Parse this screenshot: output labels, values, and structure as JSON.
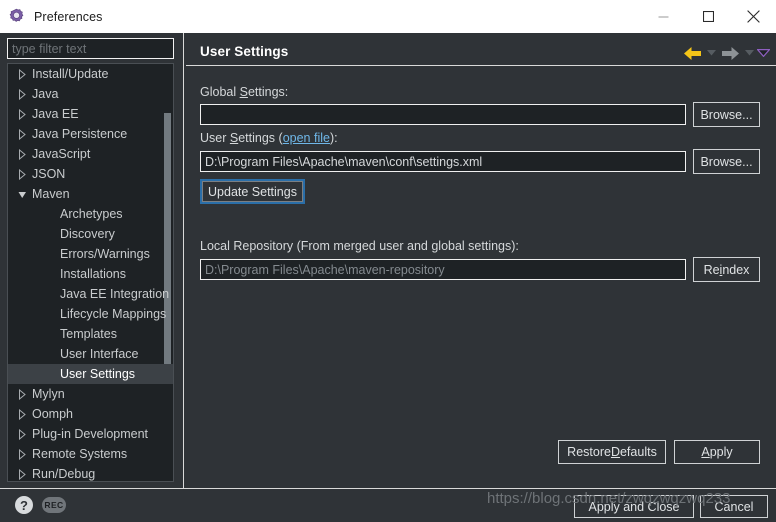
{
  "window": {
    "title": "Preferences",
    "icon": "gear-icon",
    "controls": {
      "minimize": "minimize-icon",
      "maximize": "maximize-icon",
      "close": "close-icon"
    }
  },
  "sidebar": {
    "filter": {
      "value": "",
      "placeholder": "type filter text"
    },
    "items": [
      {
        "label": "Install/Update",
        "level": 0,
        "state": "collapsed",
        "selected": false
      },
      {
        "label": "Java",
        "level": 0,
        "state": "collapsed",
        "selected": false
      },
      {
        "label": "Java EE",
        "level": 0,
        "state": "collapsed",
        "selected": false
      },
      {
        "label": "Java Persistence",
        "level": 0,
        "state": "collapsed",
        "selected": false
      },
      {
        "label": "JavaScript",
        "level": 0,
        "state": "collapsed",
        "selected": false
      },
      {
        "label": "JSON",
        "level": 0,
        "state": "collapsed",
        "selected": false
      },
      {
        "label": "Maven",
        "level": 0,
        "state": "expanded",
        "selected": false
      },
      {
        "label": "Archetypes",
        "level": 1,
        "state": "leaf",
        "selected": false
      },
      {
        "label": "Discovery",
        "level": 1,
        "state": "leaf",
        "selected": false
      },
      {
        "label": "Errors/Warnings",
        "level": 1,
        "state": "leaf",
        "selected": false
      },
      {
        "label": "Installations",
        "level": 1,
        "state": "leaf",
        "selected": false
      },
      {
        "label": "Java EE Integration",
        "level": 1,
        "state": "leaf",
        "selected": false
      },
      {
        "label": "Lifecycle Mappings",
        "level": 1,
        "state": "leaf",
        "selected": false
      },
      {
        "label": "Templates",
        "level": 1,
        "state": "leaf",
        "selected": false
      },
      {
        "label": "User Interface",
        "level": 1,
        "state": "leaf",
        "selected": false
      },
      {
        "label": "User Settings",
        "level": 1,
        "state": "leaf",
        "selected": true
      },
      {
        "label": "Mylyn",
        "level": 0,
        "state": "collapsed",
        "selected": false
      },
      {
        "label": "Oomph",
        "level": 0,
        "state": "collapsed",
        "selected": false
      },
      {
        "label": "Plug-in Development",
        "level": 0,
        "state": "collapsed",
        "selected": false
      },
      {
        "label": "Remote Systems",
        "level": 0,
        "state": "collapsed",
        "selected": false
      },
      {
        "label": "Run/Debug",
        "level": 0,
        "state": "collapsed",
        "selected": false
      }
    ]
  },
  "page": {
    "title": "User Settings",
    "nav": {
      "back": "back-arrow-icon",
      "back_menu": "chevron-down-icon",
      "forward": "forward-arrow-icon",
      "forward_menu": "chevron-down-icon",
      "view_menu": "view-menu-chevron-icon"
    },
    "global_settings": {
      "label_pre": "Global ",
      "label_mnemonic": "S",
      "label_post": "ettings:",
      "value": "",
      "placeholder": "",
      "browse_label": "Browse..."
    },
    "user_settings": {
      "label_pre": "User ",
      "label_mnemonic": "S",
      "label_mid": "ettings (",
      "link_label": "open file",
      "label_post": "):",
      "value": "D:\\Program Files\\Apache\\maven\\conf\\settings.xml",
      "browse_label": "Browse...",
      "update_label": "Update Settings"
    },
    "local_repository": {
      "label": "Local Repository (From merged user and global settings):",
      "value": "D:\\Program Files\\Apache\\maven-repository",
      "reindex_label_pre": "Re",
      "reindex_mnemonic": "i",
      "reindex_label_post": "ndex"
    },
    "restore_defaults": {
      "pre": "Restore ",
      "mnemonic": "D",
      "post": "efaults"
    },
    "apply": {
      "mnemonic": "A",
      "post": "pply"
    }
  },
  "footer": {
    "help_icon": "help-icon",
    "rec_icon": "REC",
    "apply_and_close": "Apply and Close",
    "cancel": "Cancel",
    "watermark": "https://blog.csdn.net/zwqzwqzwq233"
  },
  "colors": {
    "window_bg": "#2f3337",
    "tree_bg": "#1e2225",
    "selected_row": "#3c4146",
    "border": "#f0f0f0",
    "link": "#6fb7e8",
    "back_arrow": "#f5c518",
    "forward_arrow": "#8d9296",
    "focus_ring": "#2a6ea8",
    "titlebar_bg": "#ffffff"
  }
}
